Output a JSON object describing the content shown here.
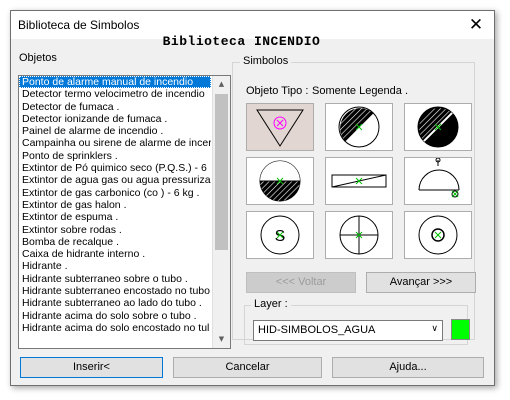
{
  "window": {
    "title": "Biblioteca de Simbolos",
    "close_glyph": "✕"
  },
  "library_title": "Biblioteca INCENDIO",
  "objects": {
    "label": "Objetos",
    "items": [
      "Ponto de alarme manual de incendio",
      "Detector termo velocimetro de incendio",
      "Detector de fumaca .",
      "Detector ionizande de fumaca .",
      "Painel de alarme de incendio .",
      "Campainha ou sirene de alarme de incer",
      "Ponto de sprinklers .",
      "Extintor de Pó quimico seco (P.Q.S.) - 6",
      "Extintor de agua gas ou agua pressuriza",
      "Extintor de gas carbonico (co ) - 6 kg .",
      "Extintor de gas halon .",
      "Extintor de espuma .",
      "Extintor sobre rodas .",
      "Bomba de recalque .",
      "Caixa de hidrante interno .",
      "Hidrante .",
      "Hidrante subterraneo sobre o tubo .",
      "Hidrante subterraneo encostado no tubo",
      "Hidrante subterraneo ao lado do tubo .",
      "Hidrante acima do solo sobre o tubo .",
      "Hidrante acima do solo encostado no tul"
    ],
    "selected_index": 0
  },
  "symbols": {
    "label": "Simbolos",
    "object_type_label": "Objeto Tipo :",
    "object_type_value": "Somente Legenda .",
    "tiles": [
      {
        "name": "triangle-alarm-symbol",
        "selected": true
      },
      {
        "name": "circle-hatched-half-symbol",
        "selected": false
      },
      {
        "name": "circle-hatched-black-symbol",
        "selected": false
      },
      {
        "name": "circle-hatched-bottom-symbol",
        "selected": false
      },
      {
        "name": "rectangle-diagonal-symbol",
        "selected": false
      },
      {
        "name": "bell-symbol",
        "selected": false
      },
      {
        "name": "circle-s-symbol",
        "selected": false
      },
      {
        "name": "circle-cross-symbol",
        "selected": false
      },
      {
        "name": "circle-ring-symbol",
        "selected": false
      }
    ],
    "back_label": "<<< Voltar",
    "next_label": "Avançar >>>"
  },
  "layer": {
    "label": "Layer :",
    "value": "HID-SIMBOLOS_AGUA",
    "color": "#00ff00"
  },
  "buttons": {
    "insert": "Inserir<",
    "cancel": "Cancelar",
    "help": "Ajuda..."
  },
  "colors": {
    "selection": "#0078d7",
    "tile_selected": "#e2d6d2",
    "marker": "#ff00ff",
    "center_mark": "#00c000"
  }
}
